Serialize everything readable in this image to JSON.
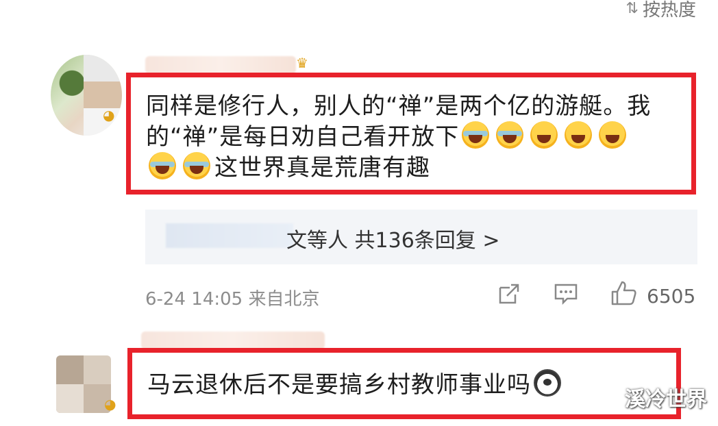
{
  "sort": {
    "label": "按热度",
    "icon": "sort-icon"
  },
  "comment1": {
    "text_line1": "同样是修行人，别人的“禅”是两个亿的游艇。我",
    "text_line2": "的“禅”是每日劝自己看开放下",
    "text_line3": "这世界真是荒唐有趣",
    "replies": "文等人 共136条回复 >",
    "meta": "6-24 14:05 来自北京",
    "like_count": "6505"
  },
  "comment2": {
    "text": "马云退休后不是要搞乡村教师事业吗"
  },
  "watermark": "溪冷世界",
  "colors": {
    "highlight_border": "#e8222b",
    "reply_bg": "#f3f5f8",
    "meta": "#8c8c8c"
  }
}
